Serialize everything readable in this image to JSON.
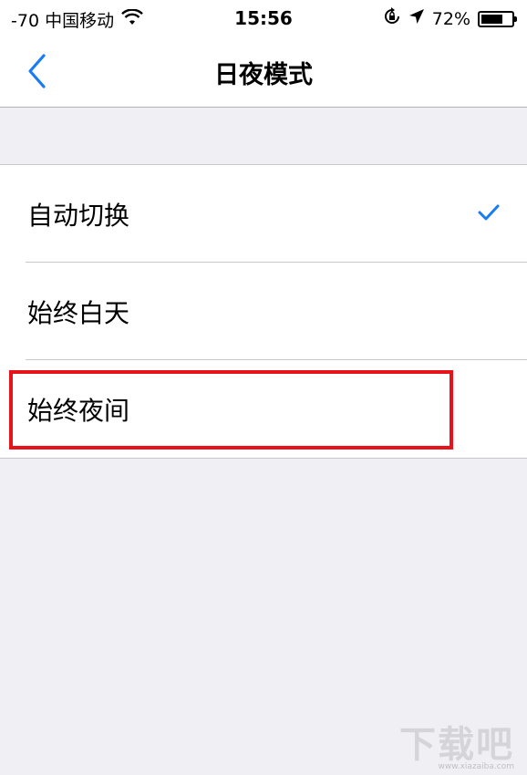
{
  "status_bar": {
    "carrier": "-70 中国移动",
    "time": "15:56",
    "battery_percent_label": "72%",
    "battery_level": 0.72,
    "icons": [
      "wifi-icon",
      "rotation-lock-icon",
      "location-arrow-icon",
      "battery-icon"
    ]
  },
  "nav": {
    "title": "日夜模式",
    "back_icon": "chevron-left-icon",
    "accent_color": "#1a7cf4"
  },
  "options": [
    {
      "label": "自动切换",
      "selected": true
    },
    {
      "label": "始终白天",
      "selected": false
    },
    {
      "label": "始终夜间",
      "selected": false
    }
  ],
  "annotation": {
    "highlight_color": "#e8131a",
    "highlighted_option": "始终夜间"
  },
  "watermark": {
    "text": "下载吧",
    "url_text": "www.xiazaiba.com"
  }
}
